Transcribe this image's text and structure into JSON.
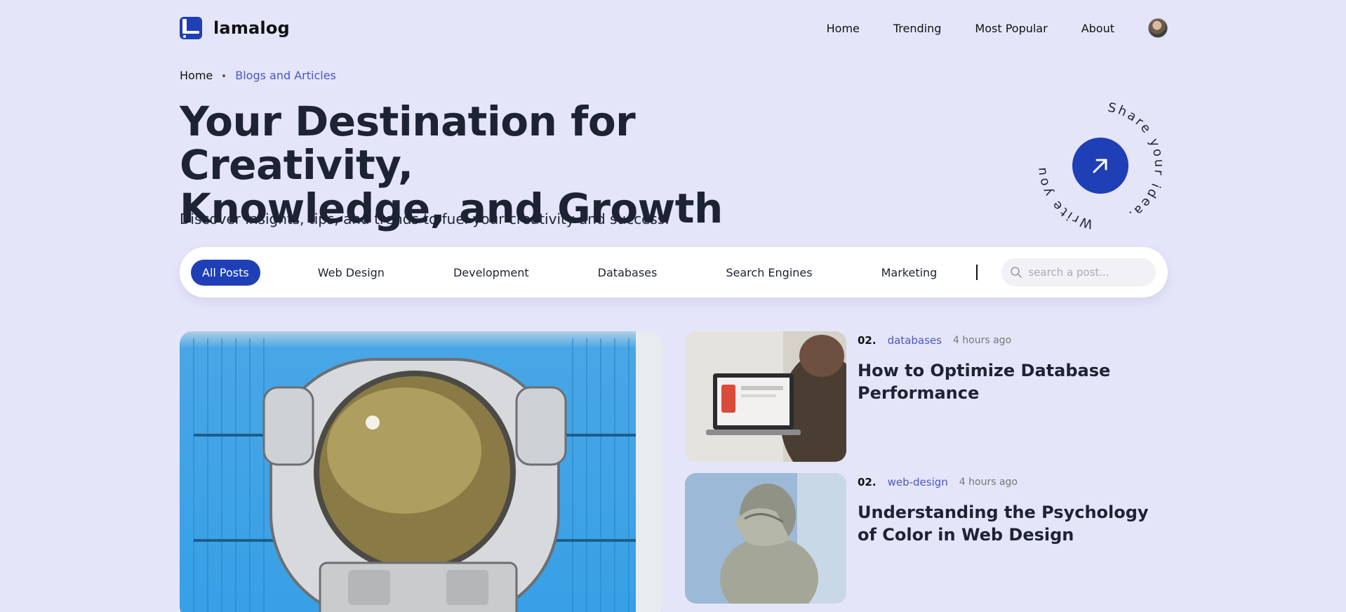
{
  "brand": {
    "name": "lamalog"
  },
  "nav": {
    "links": [
      "Home",
      "Trending",
      "Most Popular",
      "About"
    ]
  },
  "breadcrumb": {
    "home": "Home",
    "current": "Blogs and Articles"
  },
  "hero": {
    "title_line1": "Your Destination for Creativity,",
    "title_line2": "Knowledge, and Growth",
    "subtitle": "Discover insights, tips, and trends to fuel your creativity and success."
  },
  "cta": {
    "ring_top": "Share your idea.",
    "ring_bottom": "Write your story."
  },
  "filters": {
    "categories": [
      "All Posts",
      "Web Design",
      "Development",
      "Databases",
      "Search Engines",
      "Marketing"
    ],
    "active": "All Posts",
    "search_placeholder": "search a post..."
  },
  "posts": [
    {
      "num": "02.",
      "category": "databases",
      "time": "4 hours ago",
      "title": "How to Optimize Database Performance"
    },
    {
      "num": "02.",
      "category": "web-design",
      "time": "4 hours ago",
      "title": "Understanding the Psychology of Color in Web Design"
    }
  ],
  "colors": {
    "background": "#e5e5fa",
    "accent": "#1f3fb7",
    "link": "#4a57c2",
    "text": "#1d2333"
  },
  "icons": {
    "logo": "lamalog-logo-icon",
    "cta": "arrow-up-right-icon",
    "search": "search-icon"
  }
}
